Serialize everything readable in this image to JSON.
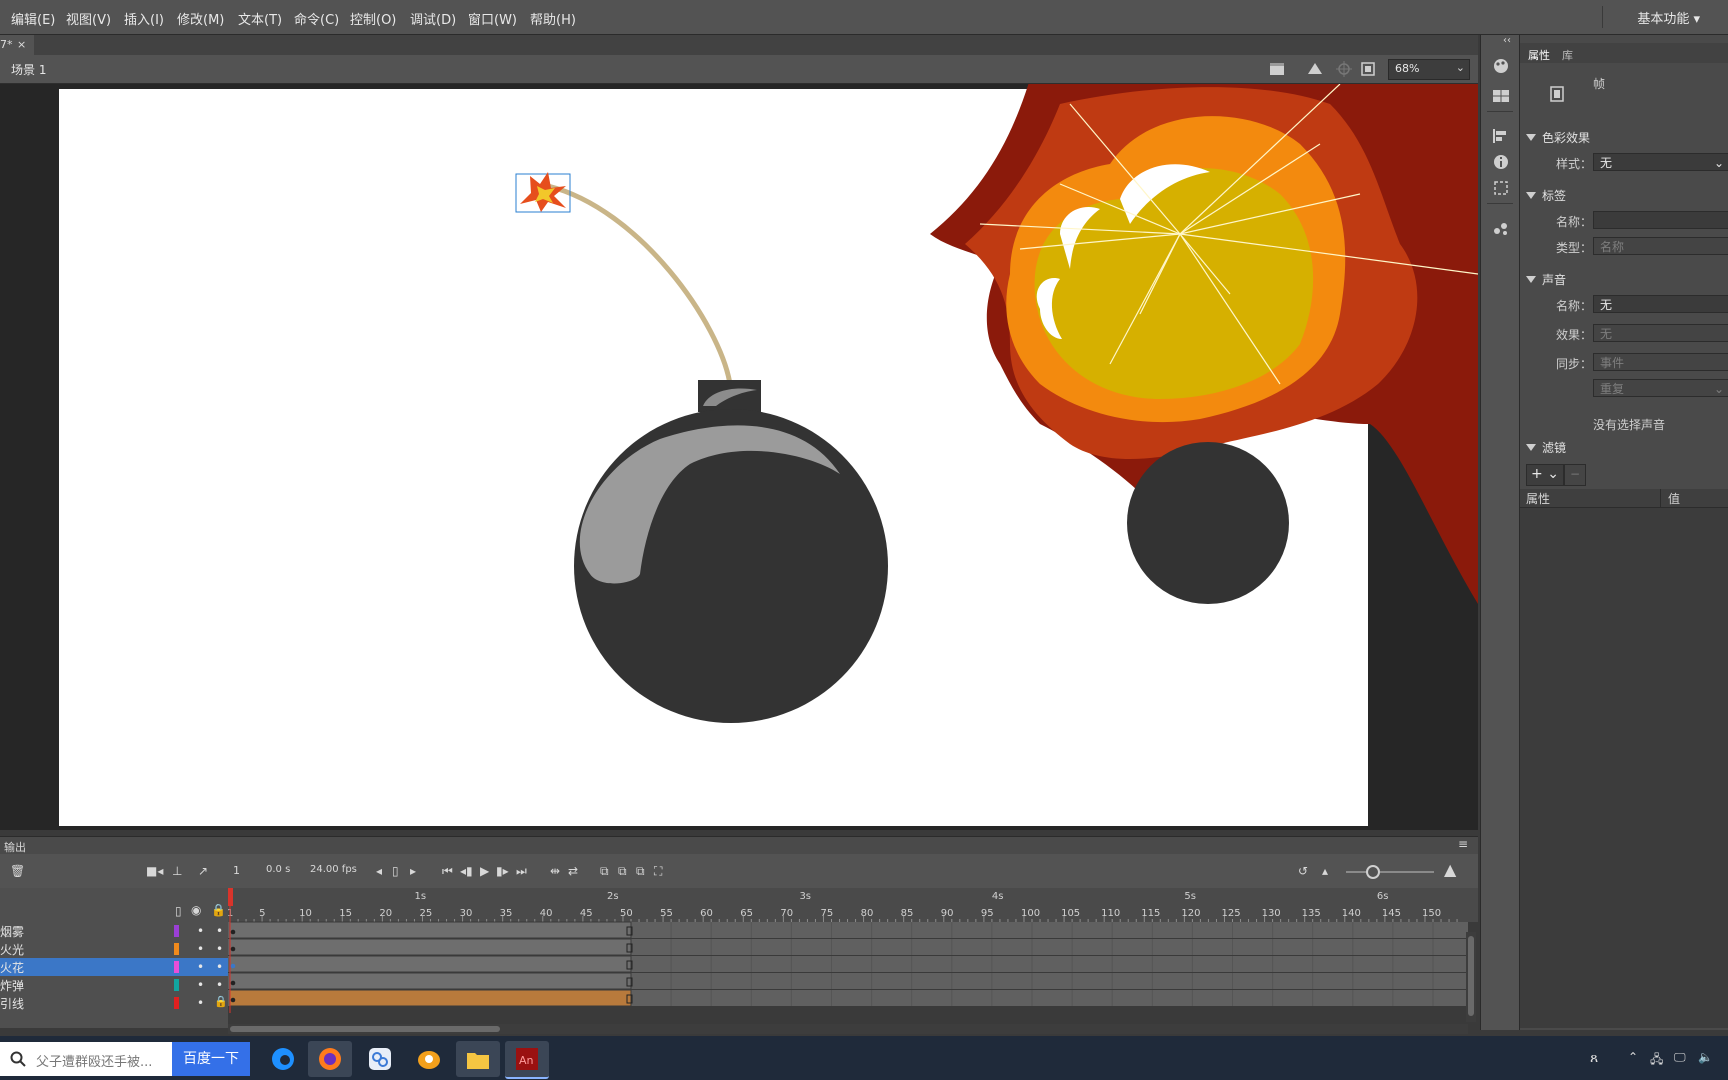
{
  "menu": [
    "编辑(E)",
    "视图(V)",
    "插入(I)",
    "修改(M)",
    "文本(T)",
    "命令(C)",
    "控制(O)",
    "调试(D)",
    "窗口(W)",
    "帮助(H)"
  ],
  "workspace_label": "基本功能",
  "doc_tab": {
    "label": "7*",
    "close": "×"
  },
  "scene": {
    "label": "场景 1"
  },
  "zoom": "68%",
  "props": {
    "tabs": [
      "属性",
      "库"
    ],
    "frame_label": "帧",
    "sections": {
      "color_effect": "色彩效果",
      "label": "标签",
      "sound": "声音",
      "filter": "滤镜"
    },
    "style_label": "样式：",
    "style_value": "无",
    "name_label": "名称：",
    "name_value": "",
    "type_label": "类型：",
    "type_value": "名称",
    "sound_name_label": "名称：",
    "sound_name_value": "无",
    "effect_label": "效果：",
    "effect_value": "无",
    "sync_label": "同步：",
    "sync_value": "事件",
    "repeat_value": "重复",
    "no_sound": "没有选择声音",
    "filter_col_prop": "属性",
    "filter_col_val": "值"
  },
  "output_label": "输出",
  "timeline": {
    "frame": "1",
    "time": "0.0 s",
    "fps": "24.00 fps",
    "ruler_ticks": [
      "1",
      "5",
      "10",
      "15",
      "20",
      "25",
      "30",
      "35",
      "40",
      "45",
      "50",
      "55",
      "60",
      "65",
      "70",
      "75",
      "80",
      "85",
      "90",
      "95",
      "100",
      "105",
      "110",
      "115",
      "120",
      "125",
      "130",
      "135",
      "140",
      "145",
      "150"
    ],
    "seconds": [
      "1s",
      "2s",
      "3s",
      "4s",
      "5s",
      "6s"
    ],
    "layers": [
      {
        "name": "烟雾",
        "color": "#9b3fd6",
        "selected": false
      },
      {
        "name": "火光",
        "color": "#f08a1c",
        "selected": false
      },
      {
        "name": "火花",
        "color": "#e84fd8",
        "selected": true
      },
      {
        "name": "炸弹",
        "color": "#11a5a0",
        "selected": false
      },
      {
        "name": "引线",
        "color": "#e02020",
        "selected": false
      }
    ]
  },
  "taskbar": {
    "search_placeholder": "父子遭群殴还手被...",
    "search_button": "百度一下"
  }
}
